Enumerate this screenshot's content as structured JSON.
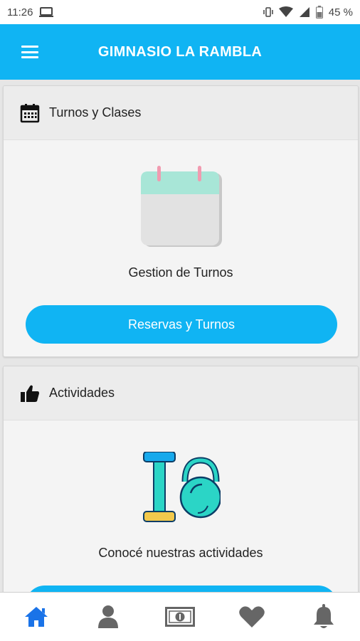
{
  "status_bar": {
    "time": "11:26",
    "battery_text": "45 %"
  },
  "app_bar": {
    "title": "GIMNASIO LA RAMBLA"
  },
  "cards": [
    {
      "title": "Turnos y Clases",
      "header_icon": "calendar-icon",
      "illustration": "calendar-illustration",
      "caption": "Gestion de Turnos",
      "button_label": "Reservas y Turnos"
    },
    {
      "title": "Actividades",
      "header_icon": "thumbs-up-icon",
      "illustration": "dumbbell-kettlebell-illustration",
      "caption": "Conocé nuestras actividades"
    }
  ],
  "bottom_nav": [
    {
      "icon": "home-icon",
      "active": true
    },
    {
      "icon": "user-icon",
      "active": false
    },
    {
      "icon": "money-icon",
      "active": false
    },
    {
      "icon": "heart-icon",
      "active": false
    },
    {
      "icon": "bell-icon",
      "active": false
    }
  ],
  "colors": {
    "primary": "#10b4f3",
    "active_nav": "#1a73e8",
    "inactive_nav": "#666666"
  }
}
